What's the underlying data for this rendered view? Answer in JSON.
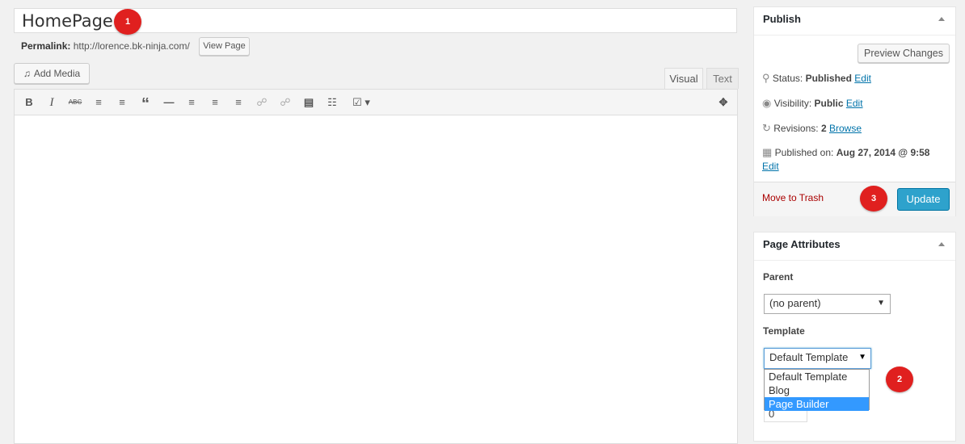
{
  "title": {
    "value": "HomePage",
    "badge": "1"
  },
  "permalink": {
    "label": "Permalink:",
    "url": "http://lorence.bk-ninja.com/",
    "view_button": "View Page"
  },
  "media": {
    "add_label": "Add Media"
  },
  "tabs": {
    "visual": "Visual",
    "text": "Text"
  },
  "toolbar_icons": [
    "bold-icon",
    "italic-icon",
    "strikethrough-icon",
    "bulleted-list-icon",
    "numbered-list-icon",
    "blockquote-icon",
    "horizontal-line-icon",
    "align-left-icon",
    "align-center-icon",
    "align-right-icon",
    "link-icon",
    "unlink-icon",
    "read-more-icon",
    "toolbar-toggle-icon",
    "shortcode-cart-icon",
    "fullscreen-icon"
  ],
  "publish": {
    "title": "Publish",
    "preview_button": "Preview Changes",
    "status_label": "Status:",
    "status_value": "Published",
    "status_edit": "Edit",
    "visibility_label": "Visibility:",
    "visibility_value": "Public",
    "visibility_edit": "Edit",
    "revisions_label": "Revisions:",
    "revisions_value": "2",
    "revisions_browse": "Browse",
    "published_label": "Published on:",
    "published_value": "Aug 27, 2014 @ 9:58",
    "published_edit": "Edit",
    "trash_link": "Move to Trash",
    "update_button": "Update",
    "badge": "3"
  },
  "attributes": {
    "title": "Page Attributes",
    "parent_label": "Parent",
    "parent_value": "(no parent)",
    "template_label": "Template",
    "template_value": "Default Template",
    "template_options": [
      "Default Template",
      "Blog",
      "Page Builder"
    ],
    "template_highlight": "Page Builder",
    "order_value": "0",
    "badge": "2"
  },
  "colors": {
    "accent": "#0073aa",
    "update_button": "#2ea2cc",
    "badge": "#e0201f",
    "trash": "#a00",
    "highlight": "#3399ff"
  }
}
